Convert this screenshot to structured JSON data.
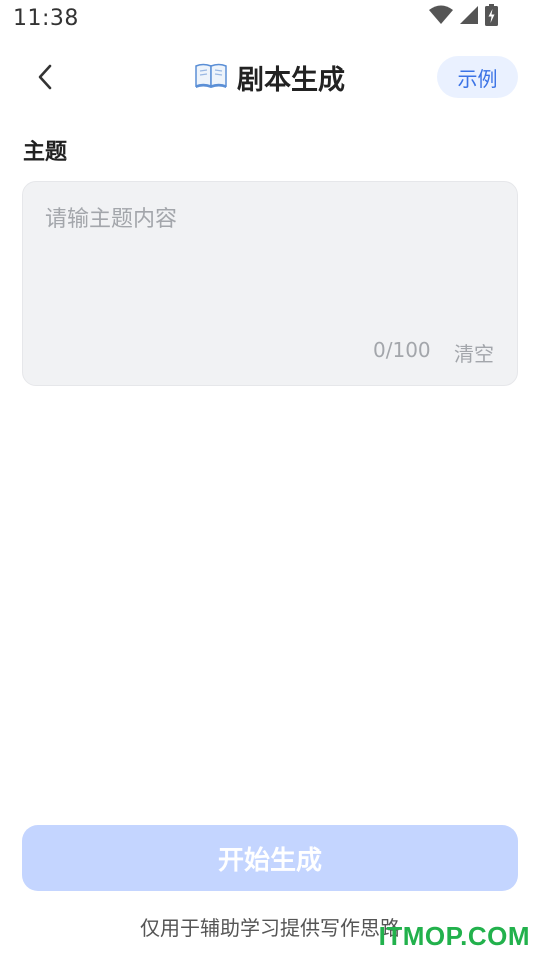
{
  "status_bar": {
    "time": "11:38",
    "icons": [
      "wifi-icon",
      "signal-icon",
      "battery-charging-icon"
    ]
  },
  "header": {
    "back_icon": "chevron-left-icon",
    "title_icon": "open-book-icon",
    "title": "剧本生成",
    "example_label": "示例"
  },
  "topic": {
    "label": "主题",
    "placeholder": "请输主题内容",
    "value": "",
    "count": "0/100",
    "clear_label": "清空"
  },
  "footer": {
    "generate_label": "开始生成",
    "disclaimer": "仅用于辅助学习提供写作思路",
    "watermark": "ITMOP.COM"
  },
  "colors": {
    "accent": "#3b73e6",
    "button_disabled": "#c4d5ff",
    "input_bg": "#f1f2f4",
    "watermark": "#22b14c"
  }
}
